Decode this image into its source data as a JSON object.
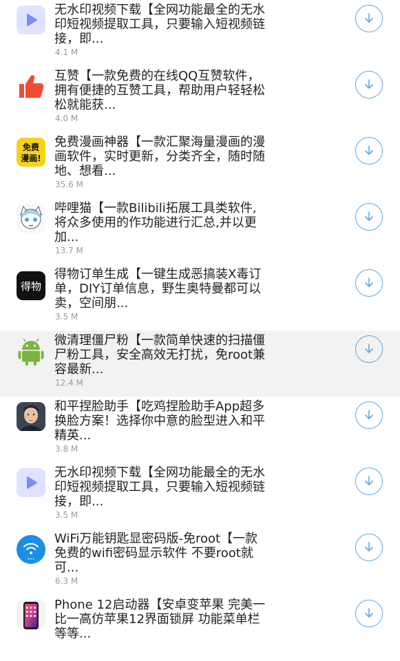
{
  "apps": [
    {
      "title": "无水印视频下载【全网功能最全的无水印短视频提取工具，只要输入短视频链接，即...",
      "size": "4.1 M",
      "icon": "play-icon",
      "icon_color": "#7b8cff"
    },
    {
      "title": "互赞【一款免费的在线QQ互赞软件，拥有便捷的互赞工具，帮助用户轻轻松松就能获...",
      "size": "4.0 M",
      "icon": "thumbs-up-icon",
      "icon_color": "#f04a34"
    },
    {
      "title": "免费漫画神器【一款汇聚海量漫画的漫画软件，实时更新，分类齐全，随时随地、想看...",
      "size": "35.6 M",
      "icon": "comic-icon",
      "icon_color": "#f7d21c",
      "icon_text": "免费\n漫画!"
    },
    {
      "title": "哔哩猫【一款Bilibili拓展工具类软件,将众多使用的作功能进行汇总,并以更加...",
      "size": "13.7 M",
      "icon": "anime-cat-icon",
      "icon_color": "#9fd3ee"
    },
    {
      "title": "得物订单生成【一键生成恶搞装X毒订单，DIY订单信息，野生奥特曼都可以卖，空间朋...",
      "size": "3.5 M",
      "icon": "dewu-icon",
      "icon_color": "#111111",
      "icon_text": "得物"
    },
    {
      "title": "微清理僵尸粉【一款简单快速的扫描僵尸粉工具，安全高效无打扰，免root兼容最新...",
      "size": "12.4 M",
      "icon": "android-icon",
      "icon_color": "#7cb342",
      "highlight": true
    },
    {
      "title": "和平捏脸助手【吃鸡捏脸助手App超多换脸方案！选择你中意的脸型进入和平精英...",
      "size": "3.8 M",
      "icon": "face-avatar-icon",
      "icon_color": "#3b4454"
    },
    {
      "title": "无水印视频下载【全网功能最全的无水印短视频提取工具，只要输入短视频链接，即...",
      "size": "3.5 M",
      "icon": "play-icon",
      "icon_color": "#7b8cff"
    },
    {
      "title": "WiFi万能钥匙显密码版-免root【一款免费的wifi密码显示软件 不要root就可...",
      "size": "6.3 M",
      "icon": "wifi-icon",
      "icon_color": "#1a8fe3"
    },
    {
      "title": "Phone 12启动器【安卓变苹果 完美一比一高仿苹果12界面锁屏 功能菜单栏等等...",
      "size": "",
      "icon": "iphone-icon",
      "icon_color": "#c23b8f"
    }
  ],
  "colors": {
    "accent": "#5aa9e6",
    "highlight_row": "#f2f2f2",
    "title_text": "#222222",
    "size_text": "#9a9a9a"
  }
}
